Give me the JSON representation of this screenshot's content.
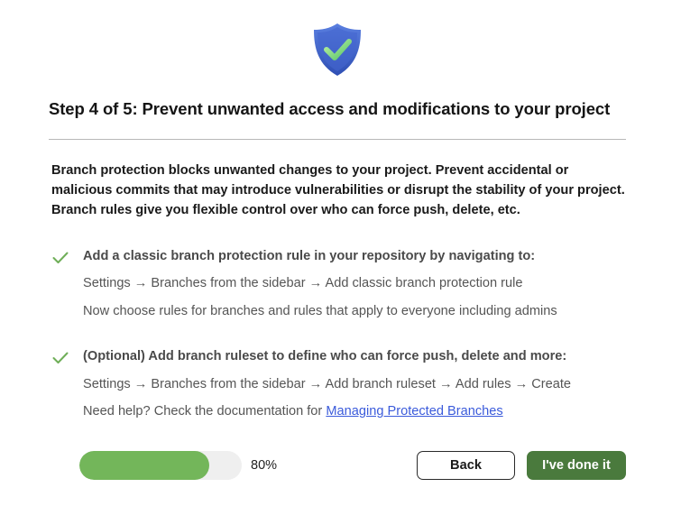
{
  "header": {
    "icon": "shield-check-icon",
    "title": "Step 4 of 5: Prevent unwanted access and modifications to your project"
  },
  "intro": {
    "text": "Branch protection blocks unwanted changes to your project. Prevent accidental or malicious commits that may introduce vulnerabilities or disrupt the stability of your project. Branch rules give you flexible control over who can force push, delete, etc."
  },
  "items": [
    {
      "icon": "check-icon",
      "heading": "Add a classic branch protection rule in your repository by navigating to:",
      "line1": "Settings → Branches from the sidebar → Add classic branch protection rule",
      "line2": "Now choose rules for branches and rules that apply to everyone including admins"
    },
    {
      "icon": "check-icon",
      "heading": "(Optional) Add branch ruleset to define who can force push, delete and more:",
      "line1": "Settings → Branches from the sidebar → Add branch ruleset → Add rules → Create",
      "help_prefix": "Need help? Check the documentation for ",
      "help_link": "Managing Protected Branches"
    }
  ],
  "progress": {
    "percent": 80,
    "label": "80%"
  },
  "buttons": {
    "back": "Back",
    "done": "I've done it"
  },
  "colors": {
    "accent": "#4a7a3d",
    "progress": "#73b65a",
    "check": "#6fae58",
    "link": "#3b5bdb",
    "shield": "#3f63c9"
  }
}
